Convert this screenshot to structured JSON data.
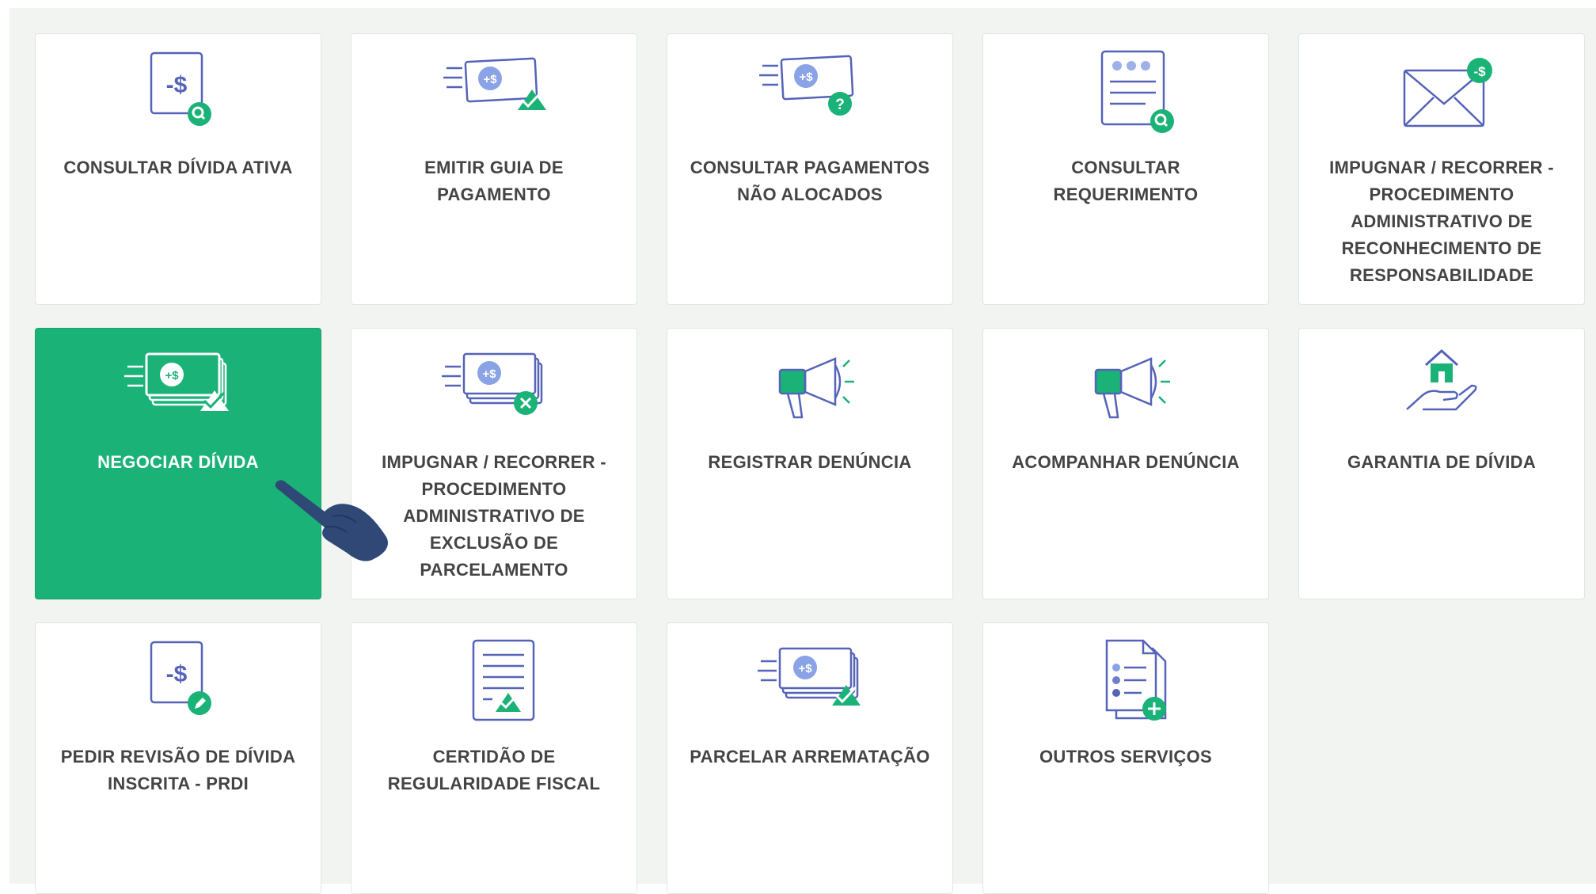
{
  "colors": {
    "accent": "#1ab277",
    "icon_stroke": "#5563b8",
    "icon_accent": "#1ab277",
    "text": "#444444",
    "background": "#f1f4f1"
  },
  "cards": [
    {
      "label": "CONSULTAR DÍVIDA ATIVA",
      "icon": "debt-search-icon",
      "active": false
    },
    {
      "label": "EMITIR GUIA DE PAGAMENTO",
      "icon": "payment-slip-check-icon",
      "active": false
    },
    {
      "label": "CONSULTAR PAGAMENTOS NÃO ALOCADOS",
      "icon": "payment-question-icon",
      "active": false
    },
    {
      "label": "CONSULTAR REQUERIMENTO",
      "icon": "document-search-icon",
      "active": false
    },
    {
      "label": "IMPUGNAR / RECORRER - PROCEDIMENTO ADMINISTRATIVO DE RECONHECIMENTO DE RESPONSABILIDADE",
      "icon": "envelope-money-icon",
      "active": false
    },
    {
      "label": "NEGOCIAR DÍVIDA",
      "icon": "money-stack-check-icon",
      "active": true
    },
    {
      "label": "IMPUGNAR / RECORRER - PROCEDIMENTO ADMINISTRATIVO DE EXCLUSÃO DE PARCELAMENTO",
      "icon": "money-stack-remove-icon",
      "active": false
    },
    {
      "label": "REGISTRAR DENÚNCIA",
      "icon": "megaphone-icon",
      "active": false
    },
    {
      "label": "ACOMPANHAR DENÚNCIA",
      "icon": "megaphone-icon",
      "active": false
    },
    {
      "label": "GARANTIA DE DÍVIDA",
      "icon": "house-in-hand-icon",
      "active": false
    },
    {
      "label": "PEDIR REVISÃO DE DÍVIDA INSCRITA - PRDI",
      "icon": "debt-edit-icon",
      "active": false
    },
    {
      "label": "CERTIDÃO DE REGULARIDADE FISCAL",
      "icon": "certificate-icon",
      "active": false
    },
    {
      "label": "PARCELAR ARREMATAÇÃO",
      "icon": "money-stack-check-icon",
      "active": false
    },
    {
      "label": "OUTROS SERVIÇOS",
      "icon": "documents-add-icon",
      "active": false
    }
  ],
  "cursor": {
    "icon": "pointing-hand-icon"
  }
}
